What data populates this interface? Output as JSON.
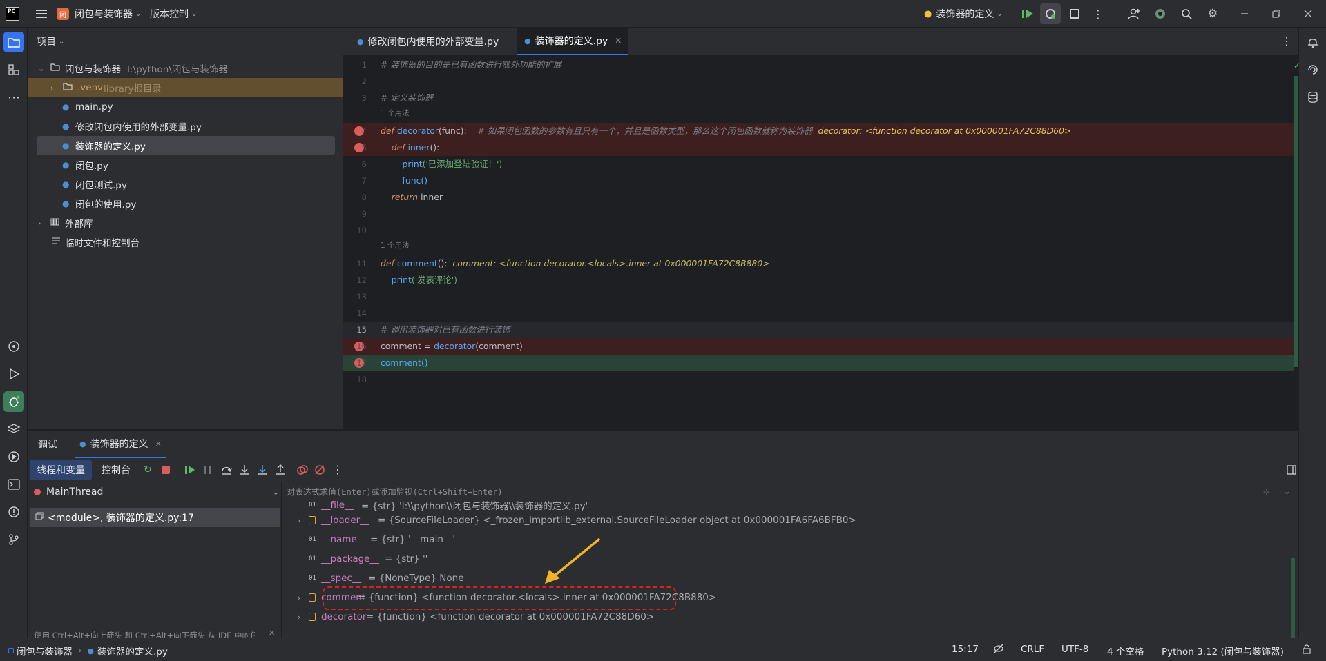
{
  "titlebar": {
    "project_name": "闭包与装饰器",
    "vcs_label": "版本控制",
    "run_config": "装饰器的定义",
    "project_badge": "闭"
  },
  "project_panel": {
    "title": "项目",
    "root_label": "闭包与装饰器",
    "root_path": "I:\\python\\闭包与装饰器",
    "venv_label": ".venv",
    "venv_hint": "library根目录",
    "files": [
      "main.py",
      "修改闭包内使用的外部变量.py",
      "装饰器的定义.py",
      "闭包.py",
      "闭包测试.py",
      "闭包的使用.py"
    ],
    "external_libs": "外部库",
    "scratches": "临时文件和控制台"
  },
  "editor": {
    "tabs": [
      {
        "label": "修改闭包内使用的外部变量.py"
      },
      {
        "label": "装饰器的定义.py"
      }
    ],
    "usage_hint": "1 个用法",
    "lines": {
      "l1": "# 装饰器的目的是已有函数进行额外功能的扩展",
      "l3": "# 定义装饰器",
      "l4_def": "def",
      "l4_name": "decorator",
      "l4_param": "(func):",
      "l4_comment": "# 如果闭包函数的参数有且只有一个，并且是函数类型，那么这个闭包函数就称为装饰器",
      "l4_inline": "decorator: <function decorator at 0x000001FA72C88D60>",
      "l5_def": "def",
      "l5_name": "inner",
      "l5_rest": "():",
      "l6_print": "print",
      "l6_str": "('已添加登陆验证！')",
      "l7": "func()",
      "l8_kw": "return",
      "l8_rest": " inner",
      "l11_def": "def",
      "l11_name": "comment",
      "l11_rest": "():",
      "l11_inline": "comment: <function decorator.<locals>.inner at 0x000001FA72C8B880>",
      "l12_print": "print",
      "l12_str": "('发表评论')",
      "l15": "# 调用装饰器对已有函数进行装饰",
      "l16_a": "comment = ",
      "l16_b": "decorator",
      "l16_c": "(comment)",
      "l17": "comment()"
    },
    "line_numbers": [
      "1",
      "2",
      "3",
      "4",
      "5",
      "6",
      "7",
      "8",
      "9",
      "10",
      "11",
      "12",
      "13",
      "14",
      "15",
      "16",
      "17",
      "18"
    ]
  },
  "debug": {
    "tab_debug": "调试",
    "tab_session": "装饰器的定义",
    "subtab_threads": "线程和变量",
    "subtab_console": "控制台",
    "thread_name": "MainThread",
    "frame": "<module>, 装饰器的定义.py:17",
    "eval_placeholder": "对表达式求值(Enter)或添加监视(Ctrl+Shift+Enter)",
    "hint": "使用 Ctrl+Alt+向上箭头 和 Ctrl+Alt+向下箭头 从 IDE 中的任...",
    "variables": [
      {
        "name": "__file__",
        "value": " = {str} 'I:\\\\python\\\\闭包与装饰器\\\\装饰器的定义.py'"
      },
      {
        "name": "__loader__",
        "value": " = {SourceFileLoader} <_frozen_importlib_external.SourceFileLoader object at 0x000001FA6FA6BFB0>"
      },
      {
        "name": "__name__",
        "value": " = {str} '__main__'"
      },
      {
        "name": "__package__",
        "value": " = {str} ''"
      },
      {
        "name": "__spec__",
        "value": " = {NoneType} None"
      },
      {
        "name": "comment",
        "value": " = {function} <function decorator.<locals>.inner at 0x000001FA72C8B880>"
      },
      {
        "name": "decorator",
        "value": " = {function} <function decorator at 0x000001FA72C88D60>"
      }
    ]
  },
  "statusbar": {
    "crumb_project": "闭包与装饰器",
    "crumb_file": "装饰器的定义.py",
    "position": "15:17",
    "line_sep": "CRLF",
    "encoding": "UTF-8",
    "indent": "4 个空格",
    "interpreter": "Python 3.12 (闭包与装饰器)"
  },
  "colors": {
    "accent": "#3574f0",
    "breakpoint": "#db5c5c",
    "annotation": "#e02020",
    "arrow": "#f0b429"
  }
}
